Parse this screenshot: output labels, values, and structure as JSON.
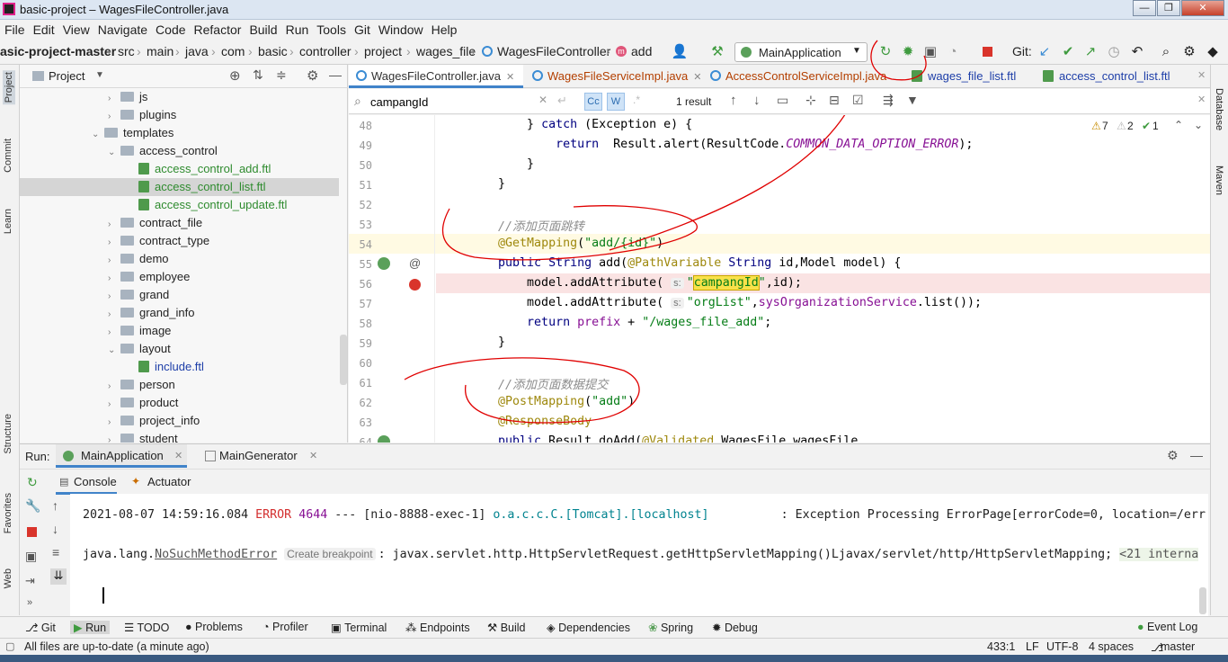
{
  "window": {
    "title": "basic-project – WagesFileController.java",
    "controls": [
      "minimize",
      "maximize",
      "close"
    ]
  },
  "menu": [
    "File",
    "Edit",
    "View",
    "Navigate",
    "Code",
    "Refactor",
    "Build",
    "Run",
    "Tools",
    "Git",
    "Window",
    "Help"
  ],
  "breadcrumbs": [
    "asic-project-master",
    "src",
    "main",
    "java",
    "com",
    "basic",
    "controller",
    "project",
    "wages_file",
    "WagesFileController",
    "add"
  ],
  "run_config": "MainApplication",
  "git_label": "Git:",
  "project_panel": {
    "title": "Project",
    "tree": [
      {
        "label": "js",
        "type": "folder",
        "indent": 1
      },
      {
        "label": "plugins",
        "type": "folder",
        "indent": 1
      },
      {
        "label": "templates",
        "type": "folder-open",
        "indent": 0
      },
      {
        "label": "access_control",
        "type": "folder-open",
        "indent": 1
      },
      {
        "label": "access_control_add.ftl",
        "type": "ftl-green",
        "indent": 2
      },
      {
        "label": "access_control_list.ftl",
        "type": "ftl-green",
        "indent": 2,
        "selected": true
      },
      {
        "label": "access_control_update.ftl",
        "type": "ftl-green",
        "indent": 2
      },
      {
        "label": "contract_file",
        "type": "folder",
        "indent": 1
      },
      {
        "label": "contract_type",
        "type": "folder",
        "indent": 1
      },
      {
        "label": "demo",
        "type": "folder",
        "indent": 1
      },
      {
        "label": "employee",
        "type": "folder",
        "indent": 1
      },
      {
        "label": "grand",
        "type": "folder",
        "indent": 1
      },
      {
        "label": "grand_info",
        "type": "folder",
        "indent": 1
      },
      {
        "label": "image",
        "type": "folder",
        "indent": 1
      },
      {
        "label": "layout",
        "type": "folder-open",
        "indent": 1
      },
      {
        "label": "include.ftl",
        "type": "ftl-blue",
        "indent": 2
      },
      {
        "label": "person",
        "type": "folder",
        "indent": 1
      },
      {
        "label": "product",
        "type": "folder",
        "indent": 1
      },
      {
        "label": "project_info",
        "type": "folder",
        "indent": 1
      },
      {
        "label": "student",
        "type": "folder",
        "indent": 1
      }
    ]
  },
  "editor_tabs": [
    {
      "label": "WagesFileController.java",
      "active": true
    },
    {
      "label": "WagesFileServiceImpl.java",
      "active": false
    },
    {
      "label": "AccessControlServiceImpl.java",
      "active": false
    },
    {
      "label": "wages_file_list.ftl",
      "active": false
    },
    {
      "label": "access_control_list.ftl",
      "active": false
    }
  ],
  "search": {
    "query": "campangId",
    "result_count": "1 result",
    "cc": "Cc",
    "w": "W"
  },
  "inspections": {
    "warnings": "7",
    "weak_warnings": "2",
    "typos": "1"
  },
  "code_lines": [
    {
      "n": "48",
      "text": "        } catch (Exception e) {"
    },
    {
      "n": "49",
      "text": "            return  Result.alert(ResultCode.COMMON_DATA_OPTION_ERROR);"
    },
    {
      "n": "50",
      "text": "        }"
    },
    {
      "n": "51",
      "text": "    }"
    },
    {
      "n": "52",
      "text": ""
    },
    {
      "n": "53",
      "text": "    //添加页面跳转"
    },
    {
      "n": "54",
      "text": "    @GetMapping(\"add/{id}\")"
    },
    {
      "n": "55",
      "text": "    public String add(@PathVariable String id,Model model) {"
    },
    {
      "n": "56",
      "text": "        model.addAttribute(  \"campangId\",id);"
    },
    {
      "n": "57",
      "text": "        model.addAttribute(  \"orgList\",sysOrganizationService.list());"
    },
    {
      "n": "58",
      "text": "        return prefix + \"/wages_file_add\";"
    },
    {
      "n": "59",
      "text": "    }"
    },
    {
      "n": "60",
      "text": ""
    },
    {
      "n": "61",
      "text": "    //添加页面数据提交"
    },
    {
      "n": "62",
      "text": "    @PostMapping(\"add\")"
    },
    {
      "n": "63",
      "text": "    @ResponseBody"
    },
    {
      "n": "64",
      "text": "    public Result doAdd(@Validated WagesFile wagesFile"
    }
  ],
  "run_panel": {
    "label": "Run:",
    "tabs": [
      "MainApplication",
      "MainGenerator"
    ],
    "subtabs": [
      "Console",
      "Actuator"
    ],
    "console": [
      {
        "ts": "2021-08-07 14:59:16.084",
        "level": "ERROR",
        "pid": "4644",
        "sep": "---",
        "thread": "[nio-8888-exec-1]",
        "logger": "o.a.c.c.C.[Tomcat].[localhost]",
        "msg": ": Exception Processing ErrorPage[errorCode=0, location=/err"
      },
      {
        "prefix": "java.lang.",
        "error_class": "NoSuchMethodError",
        "breakpoint_hint": "Create breakpoint",
        "rest": ": javax.servlet.http.HttpServletRequest.getHttpServletMapping()Ljavax/servlet/http/HttpServletMapping;",
        "internal": "<21 interna"
      }
    ]
  },
  "left_tool_windows": [
    "Project",
    "Commit",
    "Learn",
    "Structure",
    "Favorites",
    "Web"
  ],
  "right_tool_windows": [
    "Database",
    "Maven"
  ],
  "bottom_tabs": [
    "Git",
    "Run",
    "TODO",
    "Problems",
    "Profiler",
    "Terminal",
    "Endpoints",
    "Build",
    "Dependencies",
    "Spring",
    "Debug"
  ],
  "event_log": "Event Log",
  "status": {
    "message": "All files are up-to-date (a minute ago)",
    "position": "433:1",
    "line_sep": "LF",
    "encoding": "UTF-8",
    "indent": "4 spaces",
    "branch": "master"
  },
  "colors": {
    "accent": "#4083c9",
    "error": "#d32f2f",
    "annotation_red": "#e00000"
  }
}
